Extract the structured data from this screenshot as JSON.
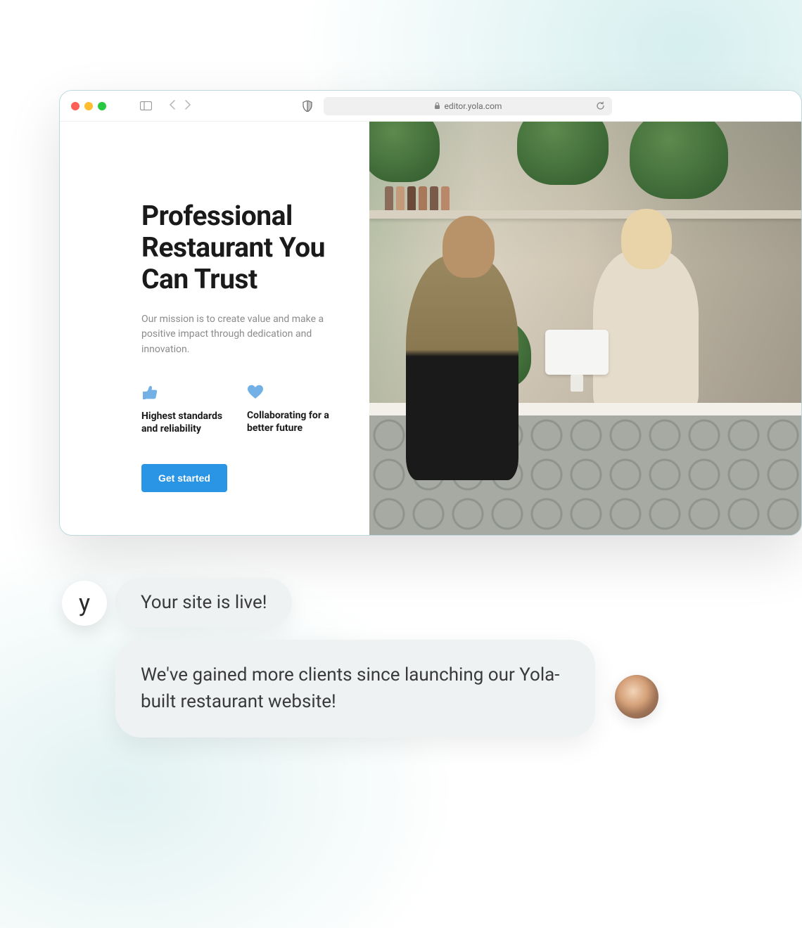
{
  "browser": {
    "url": "editor.yola.com"
  },
  "hero": {
    "headline": "Professional Restaurant You Can Trust",
    "mission": "Our mission is to create value and make a positive impact through dedication and innovation.",
    "features": [
      {
        "icon": "thumbs-up-icon",
        "title": "Highest standards and reliability"
      },
      {
        "icon": "heart-icon",
        "title": "Collaborating for a better future"
      }
    ],
    "cta": "Get started"
  },
  "chat": {
    "system_avatar_letter": "y",
    "msg1": "Your site is live!",
    "msg2": "We've gained more clients since launching our Yola-built restaurant website!"
  }
}
